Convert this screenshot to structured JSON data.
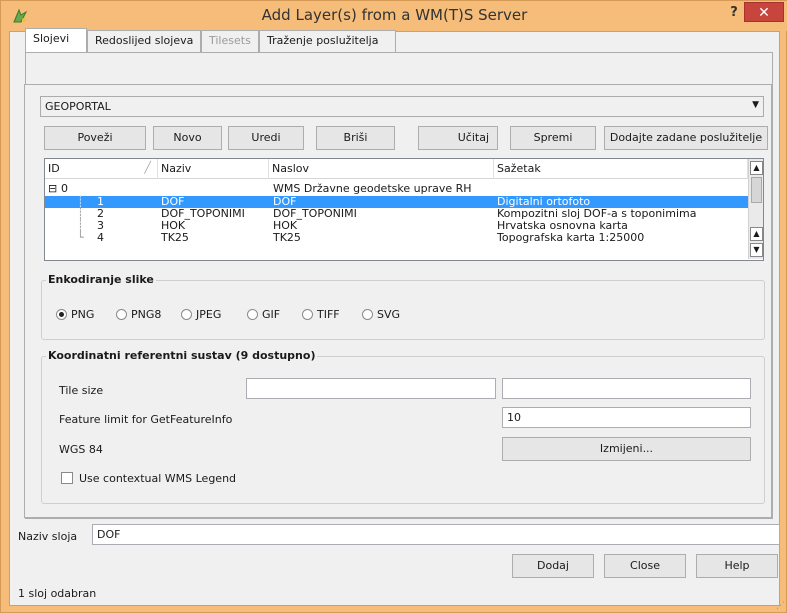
{
  "window": {
    "title": "Add Layer(s) from a WM(T)S Server",
    "help": "?",
    "close": "✕"
  },
  "tabs": [
    {
      "label": "Slojevi",
      "state": "active"
    },
    {
      "label": "Redoslijed slojeva",
      "state": "normal"
    },
    {
      "label": "Tilesets",
      "state": "disabled"
    },
    {
      "label": "Traženje poslužitelja",
      "state": "normal"
    }
  ],
  "server_combo": {
    "value": "GEOPORTAL"
  },
  "buttons": {
    "connect": "Poveži",
    "new": "Novo",
    "edit": "Uredi",
    "delete": "Briši",
    "load": "Učitaj",
    "save": "Spremi",
    "add_default": "Dodajte zadane poslužitelje"
  },
  "table": {
    "columns": [
      "ID",
      "Naziv",
      "Naslov",
      "Sažetak"
    ],
    "rows": [
      {
        "id": "0",
        "name": "",
        "title": "WMS Državne geodetske uprave RH",
        "abstract": "",
        "expander": "⊟",
        "selected": false
      },
      {
        "id": "1",
        "name": "DOF",
        "title": "DOF",
        "abstract": "Digitalni ortofoto",
        "selected": true
      },
      {
        "id": "2",
        "name": "DOF_TOPONIMI",
        "title": "DOF_TOPONIMI",
        "abstract": "Kompozitni sloj DOF-a s toponimima",
        "selected": false
      },
      {
        "id": "3",
        "name": "HOK",
        "title": "HOK",
        "abstract": "Hrvatska osnovna karta",
        "selected": false
      },
      {
        "id": "4",
        "name": "TK25",
        "title": "TK25",
        "abstract": "Topografska karta 1:25000",
        "selected": false
      }
    ]
  },
  "encoding": {
    "title": "Enkodiranje slike",
    "options": [
      "PNG",
      "PNG8",
      "JPEG",
      "GIF",
      "TIFF",
      "SVG"
    ],
    "selected": "PNG"
  },
  "crs": {
    "title": "Koordinatni referentni sustav (9 dostupno)",
    "tile_size_label": "Tile size",
    "tile_size_value_1": "",
    "tile_size_value_2": "",
    "feature_limit_label": "Feature limit for GetFeatureInfo",
    "feature_limit_value": "10",
    "crs_label": "WGS 84",
    "change_button": "Izmijeni...",
    "contextual_legend_label": "Use contextual WMS Legend",
    "contextual_legend_checked": false
  },
  "layer_name": {
    "label": "Naziv sloja",
    "value": "DOF"
  },
  "footer_buttons": {
    "add": "Dodaj",
    "close": "Close",
    "help": "Help"
  },
  "status": "1 sloj odabran",
  "colors": {
    "titlebar": "#f5bd79",
    "close": "#c7453d",
    "selection": "#3399ff"
  }
}
